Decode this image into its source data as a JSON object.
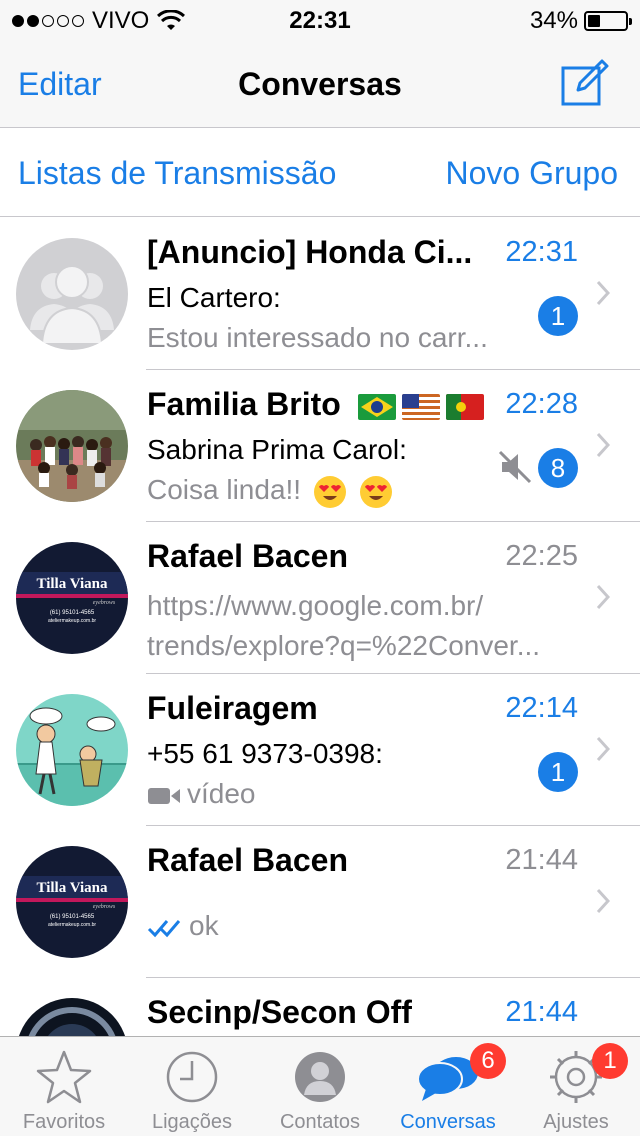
{
  "status": {
    "carrier": "VIVO",
    "time": "22:31",
    "battery": "34%",
    "battery_level": 0.34,
    "signal_bars_filled": 2,
    "signal_bars_total": 5
  },
  "nav": {
    "edit_label": "Editar",
    "title": "Conversas",
    "compose_icon": "compose-icon"
  },
  "sub": {
    "broadcast_label": "Listas de Transmissão",
    "new_group_label": "Novo Grupo"
  },
  "chats": [
    {
      "name": "[Anuncio] Honda Ci...",
      "time": "22:31",
      "sender": "El Cartero:",
      "preview": "Estou interessado no carr...",
      "unread": "1",
      "avatar": "default-avatar"
    },
    {
      "name": "Familia Brito",
      "time": "22:28",
      "sender": "Sabrina Prima Carol:",
      "preview": "Coisa linda!!",
      "unread": "8",
      "muted": true,
      "avatar": "group-photo"
    },
    {
      "name": "Rafael Bacen",
      "time": "22:25",
      "preview_line1": "https://www.google.com.br/",
      "preview_line2": "trends/explore?q=%22Conver...",
      "avatar": "tilla-viana"
    },
    {
      "name": "Fuleiragem",
      "time": "22:14",
      "sender": "+55 61 9373-0398:",
      "preview": "vídeo",
      "unread": "1",
      "avatar": "cartoon"
    },
    {
      "name": "Rafael Bacen",
      "time": "21:44",
      "preview": "ok",
      "avatar": "tilla-viana"
    },
    {
      "name": "Secinp/Secon Off",
      "time": "21:44",
      "avatar": "dark-logo"
    }
  ],
  "avatar_text": {
    "logo_title": "Tilla Viana",
    "logo_subtitle": "eyebrows",
    "logo_phone": "(61) 95101-4565",
    "logo_site": "ateliermakeup.com.br"
  },
  "tabs": [
    {
      "label": "Favoritos",
      "icon": "star-icon"
    },
    {
      "label": "Ligações",
      "icon": "clock-icon"
    },
    {
      "label": "Contatos",
      "icon": "contacts-icon"
    },
    {
      "label": "Conversas",
      "icon": "chat-bubbles-icon",
      "badge": "6",
      "active": true
    },
    {
      "label": "Ajustes",
      "icon": "gear-icon",
      "badge": "1"
    }
  ],
  "colors": {
    "accent": "#1a7ee6",
    "badge_red": "#ff3b30",
    "secondary_text": "#8e8e93"
  }
}
